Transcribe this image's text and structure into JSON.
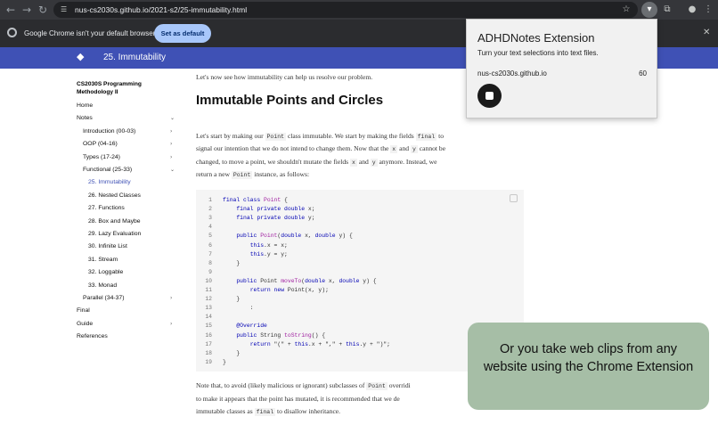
{
  "browser": {
    "url": "nus-cs2030s.github.io/2021-s2/25-immutability.html",
    "icons": [
      "back-arrow-icon",
      "forward-arrow-icon",
      "reload-icon",
      "site-info-icon",
      "star-icon",
      "extensions-icon",
      "profile-icon",
      "more-menu-icon"
    ]
  },
  "infobar": {
    "message": "Google Chrome isn't your default browser",
    "button_label": "Set as default"
  },
  "site": {
    "title": "25. Immutability"
  },
  "sidebar": {
    "title": "CS2030S Programming Methodology II",
    "items": [
      {
        "label": "Home"
      },
      {
        "label": "Notes"
      },
      {
        "label": "Introduction (00-03)"
      },
      {
        "label": "OOP (04-16)"
      },
      {
        "label": "Types (17-24)"
      },
      {
        "label": "Functional (25-33)"
      },
      {
        "label": "25. Immutability"
      },
      {
        "label": "26. Nested Classes"
      },
      {
        "label": "27. Functions"
      },
      {
        "label": "28. Box and Maybe"
      },
      {
        "label": "29. Lazy Evaluation"
      },
      {
        "label": "30. Infinite List"
      },
      {
        "label": "31. Stream"
      },
      {
        "label": "32. Loggable"
      },
      {
        "label": "33. Monad"
      },
      {
        "label": "Parallel (34-37)"
      },
      {
        "label": "Final"
      },
      {
        "label": "Guide"
      },
      {
        "label": "References"
      }
    ]
  },
  "content": {
    "intro": "Let's now see how immutability can help us resolve our problem.",
    "heading": "Immutable Points and Circles",
    "para1": {
      "t1": "Let's start by making our",
      "c1": "Point",
      "t2": "class immutable. We start by making the fields",
      "c2": "final",
      "t3": "to",
      "line2a": "signal our intention that we do not intend to change them. Now that the",
      "c3": "x",
      "and1": "and",
      "c4": "y",
      "line2b": "cannot be",
      "line3a": "changed, to move a point, we shouldn't mutate the fields",
      "c5": "x",
      "and2": "and",
      "c6": "y",
      "line3b": "anymore. Instead, we",
      "line4a": "return a new",
      "c7": "Point",
      "line4b": "instance, as follows:"
    },
    "code_lines": [
      {
        "n": "1",
        "parts": [
          [
            "kw",
            "final class "
          ],
          [
            "fn",
            "Point"
          ],
          [
            "t",
            " {"
          ]
        ]
      },
      {
        "n": "2",
        "parts": [
          [
            "t",
            "    "
          ],
          [
            "kw",
            "final private double"
          ],
          [
            "t",
            " x;"
          ]
        ]
      },
      {
        "n": "3",
        "parts": [
          [
            "t",
            "    "
          ],
          [
            "kw",
            "final private double"
          ],
          [
            "t",
            " y;"
          ]
        ]
      },
      {
        "n": "4",
        "parts": []
      },
      {
        "n": "5",
        "parts": [
          [
            "t",
            "    "
          ],
          [
            "kw",
            "public "
          ],
          [
            "fn",
            "Point"
          ],
          [
            "t",
            "("
          ],
          [
            "kw",
            "double"
          ],
          [
            "t",
            " x, "
          ],
          [
            "kw",
            "double"
          ],
          [
            "t",
            " y) {"
          ]
        ]
      },
      {
        "n": "6",
        "parts": [
          [
            "t",
            "        "
          ],
          [
            "kw",
            "this"
          ],
          [
            "t",
            ".x = x;"
          ]
        ]
      },
      {
        "n": "7",
        "parts": [
          [
            "t",
            "        "
          ],
          [
            "kw",
            "this"
          ],
          [
            "t",
            ".y = y;"
          ]
        ]
      },
      {
        "n": "8",
        "parts": [
          [
            "t",
            "    }"
          ]
        ]
      },
      {
        "n": "9",
        "parts": []
      },
      {
        "n": "10",
        "parts": [
          [
            "t",
            "    "
          ],
          [
            "kw",
            "public"
          ],
          [
            "t",
            " Point "
          ],
          [
            "fn",
            "moveTo"
          ],
          [
            "t",
            "("
          ],
          [
            "kw",
            "double"
          ],
          [
            "t",
            " x, "
          ],
          [
            "kw",
            "double"
          ],
          [
            "t",
            " y) {"
          ]
        ]
      },
      {
        "n": "11",
        "parts": [
          [
            "t",
            "        "
          ],
          [
            "kw",
            "return new"
          ],
          [
            "t",
            " Point(x, y);"
          ]
        ]
      },
      {
        "n": "12",
        "parts": [
          [
            "t",
            "    }"
          ]
        ]
      },
      {
        "n": "13",
        "parts": [
          [
            "t",
            "        :"
          ]
        ]
      },
      {
        "n": "14",
        "parts": []
      },
      {
        "n": "15",
        "parts": [
          [
            "t",
            "    "
          ],
          [
            "kw",
            "@Override"
          ]
        ]
      },
      {
        "n": "16",
        "parts": [
          [
            "t",
            "    "
          ],
          [
            "kw",
            "public"
          ],
          [
            "t",
            " String "
          ],
          [
            "fn",
            "toString"
          ],
          [
            "t",
            "() {"
          ]
        ]
      },
      {
        "n": "17",
        "parts": [
          [
            "t",
            "        "
          ],
          [
            "kw",
            "return"
          ],
          [
            "t",
            " \"(\" + "
          ],
          [
            "kw",
            "this"
          ],
          [
            "t",
            ".x + \",\" + "
          ],
          [
            "kw",
            "this"
          ],
          [
            "t",
            ".y + \")\";"
          ]
        ]
      },
      {
        "n": "18",
        "parts": [
          [
            "t",
            "    }"
          ]
        ]
      },
      {
        "n": "19",
        "parts": [
          [
            "t",
            "}"
          ]
        ]
      }
    ],
    "para2": {
      "line1a": "Note that, to avoid (likely malicious or ignorant) subclasses of",
      "c1": "Point",
      "line1b": "overridi",
      "line2": "to make it appears that the point has mutated, it is recommended that we de",
      "line3a": "immutable classes as",
      "c2": "final",
      "line3b": "to disallow inheritance."
    }
  },
  "popup": {
    "title": "ADHDNotes Extension",
    "subtitle": "Turn your text selections into text files.",
    "site": "nus-cs2030s.github.io",
    "count": "60"
  },
  "callout": {
    "text": "Or you take web clips from any website using the Chrome Extension"
  },
  "colors": {
    "header": "#3f51b5",
    "callout": "#a6bea6",
    "set_default_button": "#a8c7fa"
  }
}
